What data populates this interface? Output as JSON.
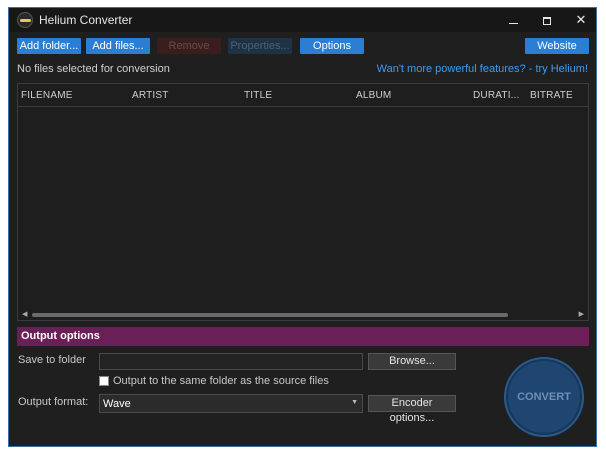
{
  "window": {
    "title": "Helium Converter"
  },
  "toolbar": {
    "add_folder": "Add folder...",
    "add_files": "Add files...",
    "remove": "Remove",
    "properties": "Properties...",
    "options": "Options",
    "website": "Website"
  },
  "status_text": "No files selected for conversion",
  "promo_link": "Wan't more powerful features? - try Helium!",
  "file_table": {
    "columns": [
      "FILENAME",
      "ARTIST",
      "TITLE",
      "ALBUM",
      "DURATI...",
      "BITRATE"
    ],
    "rows": []
  },
  "output_options": {
    "header": "Output options",
    "save_to_folder_label": "Save to folder",
    "save_to_folder_value": "",
    "browse_button": "Browse...",
    "same_folder_checkbox_label": "Output to the same folder as the source files",
    "same_folder_checked": false,
    "output_format_label": "Output format:",
    "output_format_value": "Wave",
    "encoder_options_button": "Encoder options...",
    "convert_button": "CONVERT"
  },
  "colors": {
    "accent_blue": "#2a7fd4",
    "output_header": "#6b1f57",
    "link": "#3c9cf0",
    "background": "#1f1f1f"
  }
}
